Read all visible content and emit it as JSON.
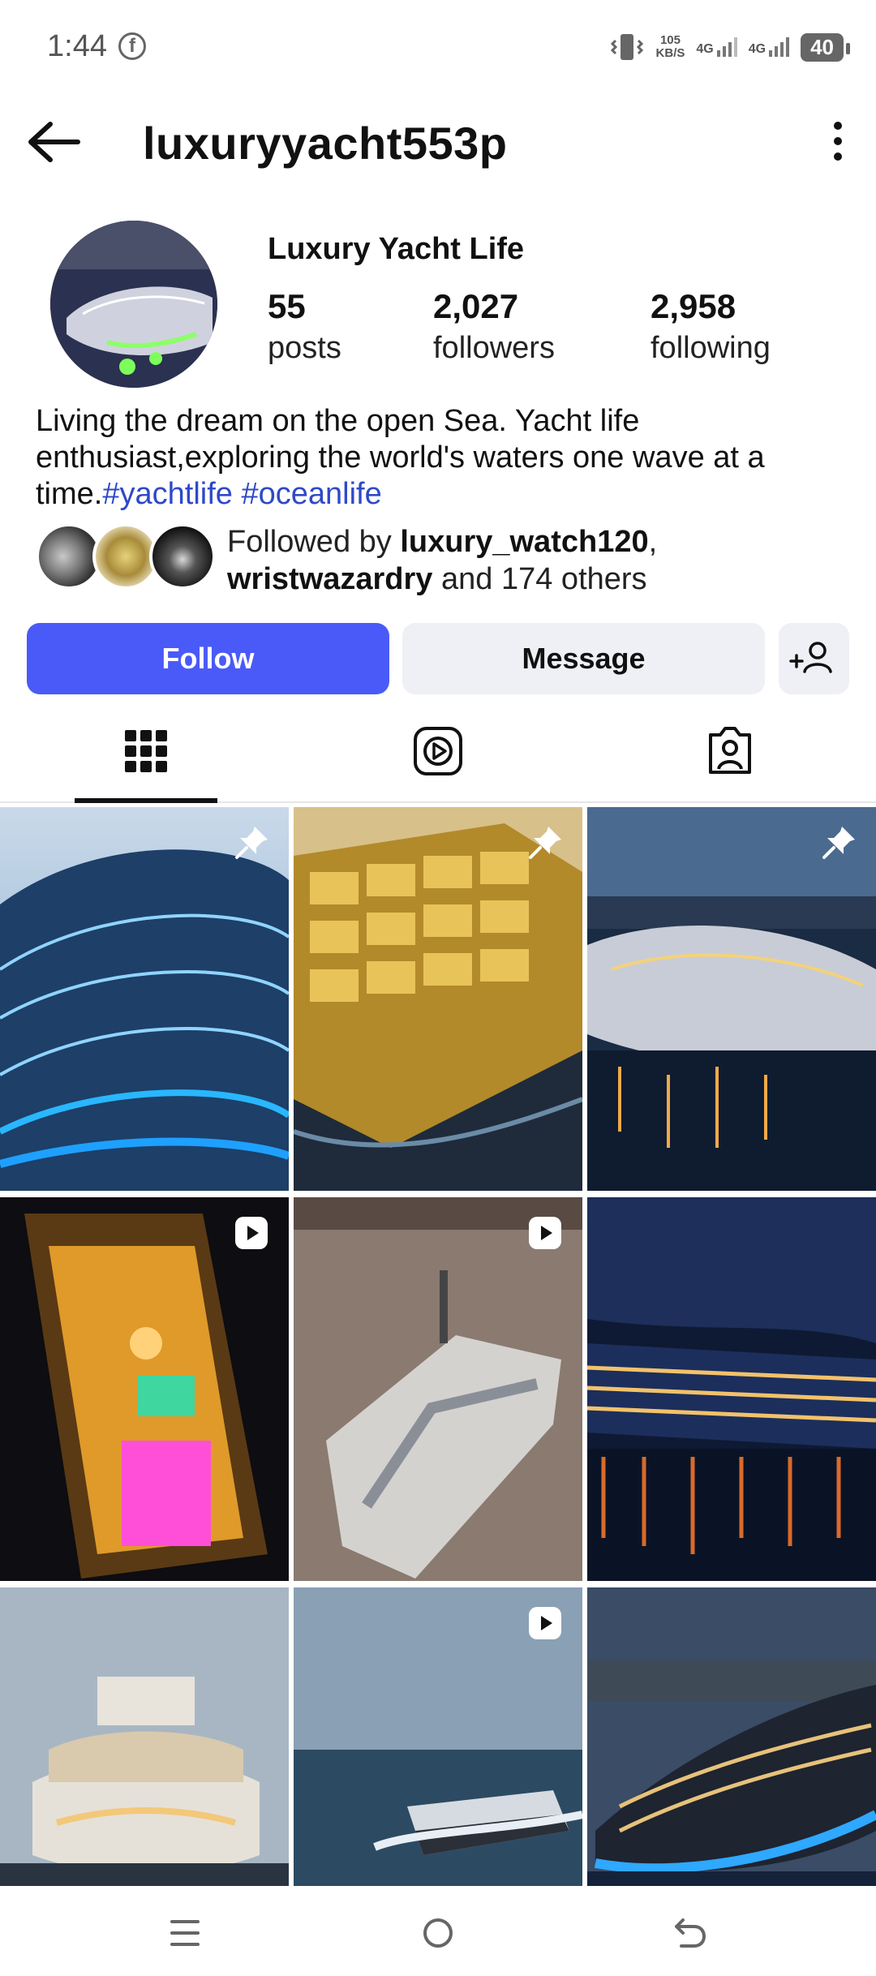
{
  "status_bar": {
    "time": "1:44",
    "speed_value": "105",
    "speed_unit": "KB/S",
    "network_1": "4G",
    "network_2": "4G",
    "battery": "40"
  },
  "header": {
    "username": "luxuryyacht553p"
  },
  "profile": {
    "display_name": "Luxury Yacht Life",
    "stats": [
      {
        "value": "55",
        "label": "posts"
      },
      {
        "value": "2,027",
        "label": "followers"
      },
      {
        "value": "2,958",
        "label": "following"
      }
    ],
    "bio_text": "Living the dream on the open Sea. Yacht life enthusiast,exploring the world's waters one wave at a time.",
    "bio_tags": "#yachtlife #oceanlife",
    "followed_by": {
      "prefix": "Followed by ",
      "user1": "luxury_watch120",
      "separator": ",",
      "user2": "wristwazardry",
      "suffix": " and 174 others"
    }
  },
  "actions": {
    "follow_label": "Follow",
    "message_label": "Message"
  },
  "tabs": {
    "active": "posts-grid"
  },
  "accent": "#4a5af8",
  "hashtag_color": "#2e49c8"
}
